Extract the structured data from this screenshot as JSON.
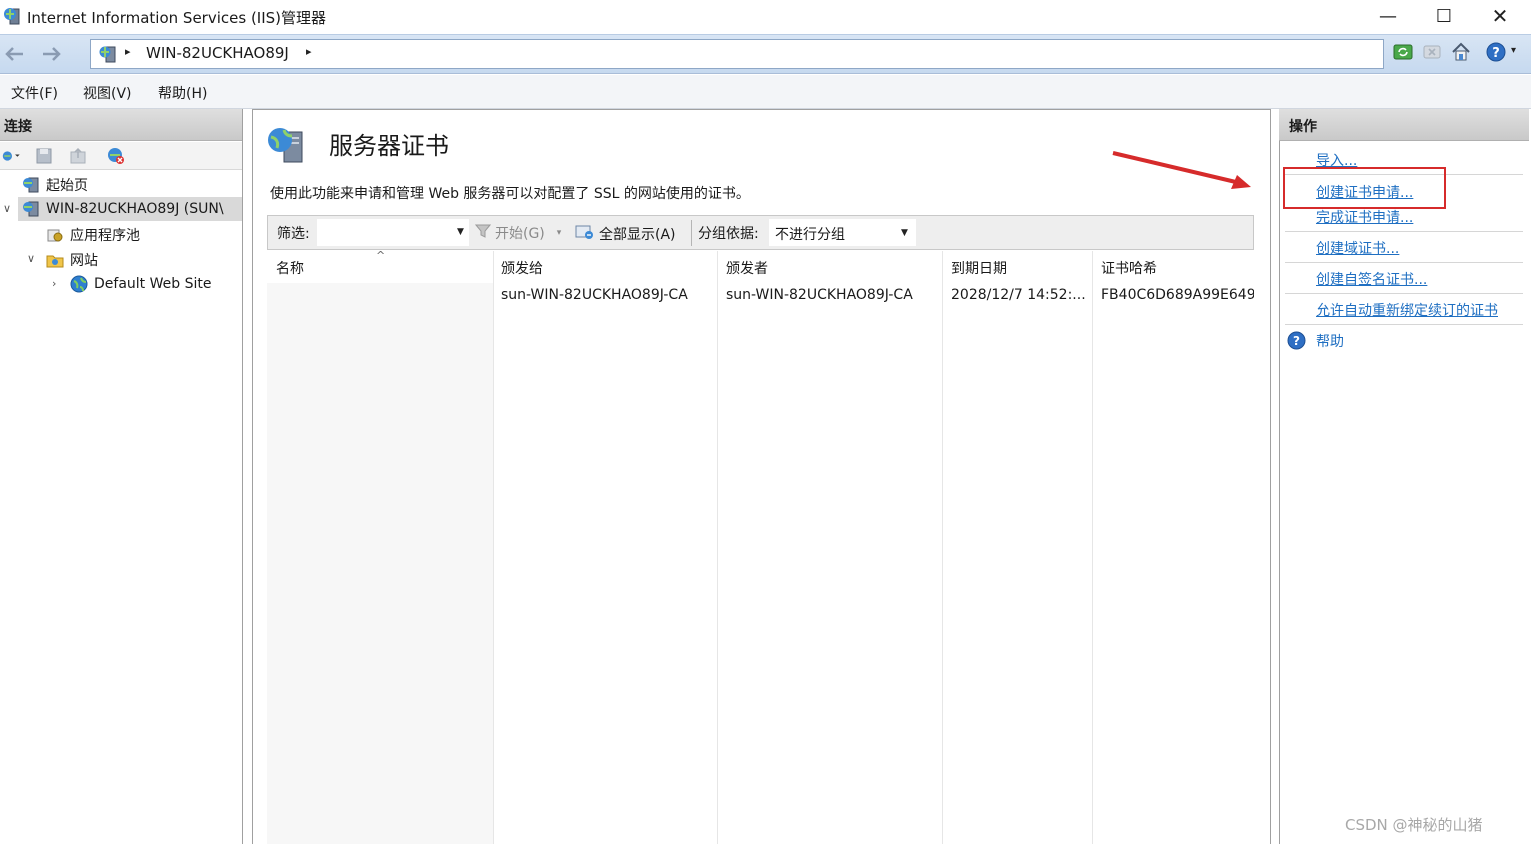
{
  "window": {
    "title": "Internet Information Services (IIS)管理器",
    "controls": {
      "minimize": "—",
      "maximize": "☐",
      "close": "✕"
    }
  },
  "address_bar": {
    "path": "WIN-82UCKHAO89J",
    "separator": "▸"
  },
  "menu": {
    "file": "文件(F)",
    "view": "视图(V)",
    "help": "帮助(H)"
  },
  "connections": {
    "title": "连接",
    "tree": [
      {
        "label": "起始页",
        "icon": "start-page-icon"
      },
      {
        "label": "WIN-82UCKHAO89J (SUN\\",
        "icon": "server-icon",
        "expanded": true,
        "selected": true
      },
      {
        "label": "应用程序池",
        "icon": "app-pool-icon"
      },
      {
        "label": "网站",
        "icon": "sites-folder-icon",
        "expanded": true
      },
      {
        "label": "Default Web Site",
        "icon": "globe-icon",
        "expanded": false
      }
    ]
  },
  "main": {
    "title": "服务器证书",
    "description": "使用此功能来申请和管理 Web 服务器可以对配置了 SSL 的网站使用的证书。",
    "filter": {
      "label": "筛选:",
      "value": "",
      "go_label": "开始(G)",
      "show_all_label": "全部显示(A)",
      "group_label": "分组依据:",
      "group_value": "不进行分组"
    },
    "table": {
      "columns": [
        "名称",
        "颁发给",
        "颁发者",
        "到期日期",
        "证书哈希"
      ],
      "rows": [
        [
          "",
          "sun-WIN-82UCKHAO89J-CA",
          "sun-WIN-82UCKHAO89J-CA",
          "2028/12/7 14:52:...",
          "FB40C6D689A99E649"
        ]
      ]
    }
  },
  "actions": {
    "title": "操作",
    "items": [
      {
        "label": "导入..."
      },
      {
        "label": "创建证书申请..."
      },
      {
        "label": "完成证书申请..."
      },
      {
        "label": "创建域证书..."
      },
      {
        "label": "创建自签名证书..."
      },
      {
        "label": "允许自动重新绑定续订的证书"
      },
      {
        "label": "帮助"
      }
    ]
  },
  "annotation": {
    "highlight_color": "#d62b2b",
    "highlighted_action": "创建证书申请..."
  },
  "watermark": "CSDN @神秘的山猪"
}
